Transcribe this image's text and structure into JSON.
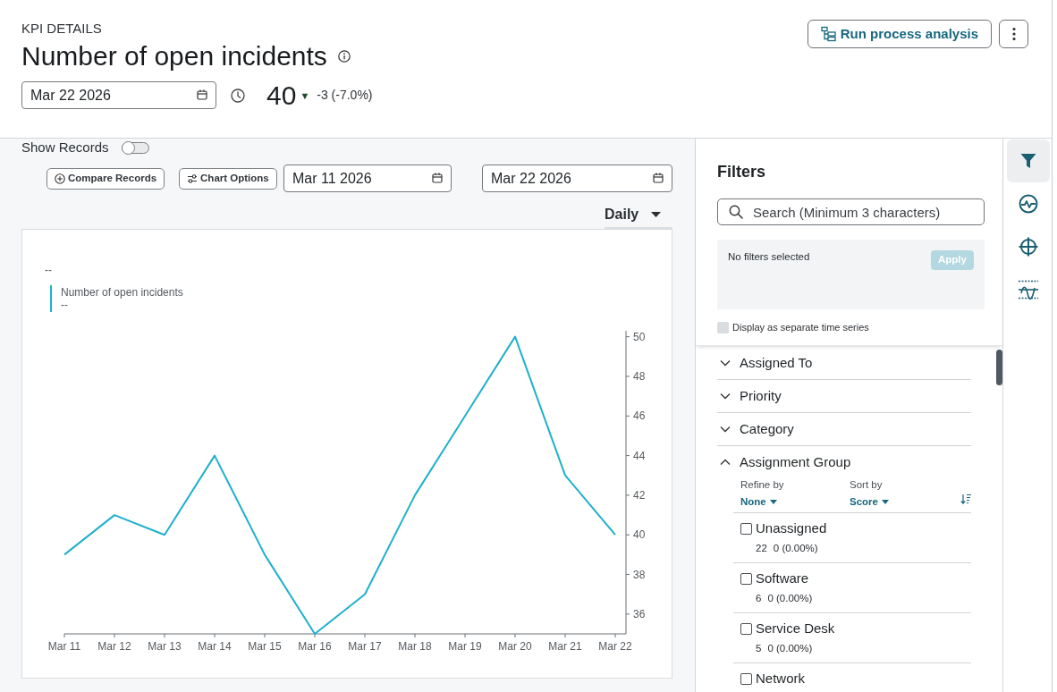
{
  "header": {
    "eyebrow": "KPI DETAILS",
    "title": "Number of open incidents",
    "date": "Mar 22 2026",
    "score": "40",
    "trend": "▼",
    "change": "-3 (-7.0%)",
    "run_button": "Run process analysis"
  },
  "chart_panel": {
    "show_records": {
      "label": "Show Records",
      "on": false
    },
    "buttons": [
      {
        "kind": "compare",
        "label": "Compare Records"
      },
      {
        "kind": "options",
        "label": "Chart Options"
      }
    ],
    "date_from": "Mar 11 2026",
    "date_to": "Mar 22 2026",
    "interval": "Daily",
    "headline": "--",
    "legend_value": "--",
    "chart_data": {
      "type": "line",
      "categories": [
        "Mar 11",
        "Mar 12",
        "Mar 13",
        "Mar 14",
        "Mar 15",
        "Mar 16",
        "Mar 17",
        "Mar 18",
        "Mar 19",
        "Mar 20",
        "Mar 21",
        "Mar 22"
      ],
      "series": [
        {
          "name": "Number of open incidents",
          "color": "#1fb0cc",
          "values": [
            39,
            41,
            40,
            44,
            39,
            35,
            37,
            42,
            46,
            50,
            43,
            40
          ]
        }
      ],
      "ylim": [
        35,
        50.3
      ],
      "yticks": [
        36,
        38,
        40,
        42,
        44,
        46,
        48,
        50
      ]
    }
  },
  "filters": {
    "title": "Filters",
    "search": {
      "placeholder": "Search (Minimum 3 characters)"
    },
    "selection_text": "No filters selected",
    "apply": {
      "label": "Apply",
      "disabled": true
    },
    "separate_series": {
      "label": "Display as separate time series",
      "checked": false,
      "disabled": true
    },
    "groups": [
      {
        "label": "Assigned To",
        "expanded": false
      },
      {
        "label": "Priority",
        "expanded": false
      },
      {
        "label": "Category",
        "expanded": false
      },
      {
        "label": "Assignment Group",
        "expanded": true,
        "refine_label": "Refine by",
        "refine_value": "None",
        "sort_label": "Sort by",
        "sort_value": "Score",
        "options": [
          {
            "label": "Unassigned",
            "count": "22",
            "change": "0 (0.00%)",
            "checked": false
          },
          {
            "label": "Software",
            "count": "6",
            "change": "0 (0.00%)",
            "checked": false
          },
          {
            "label": "Service Desk",
            "count": "5",
            "change": "0 (0.00%)",
            "checked": false
          },
          {
            "label": "Network",
            "checked": false
          }
        ]
      }
    ]
  },
  "rail": [
    {
      "kind": "filter",
      "selected": true
    },
    {
      "kind": "pulse",
      "selected": false
    },
    {
      "kind": "target",
      "selected": false
    },
    {
      "kind": "threshold",
      "selected": false
    }
  ]
}
